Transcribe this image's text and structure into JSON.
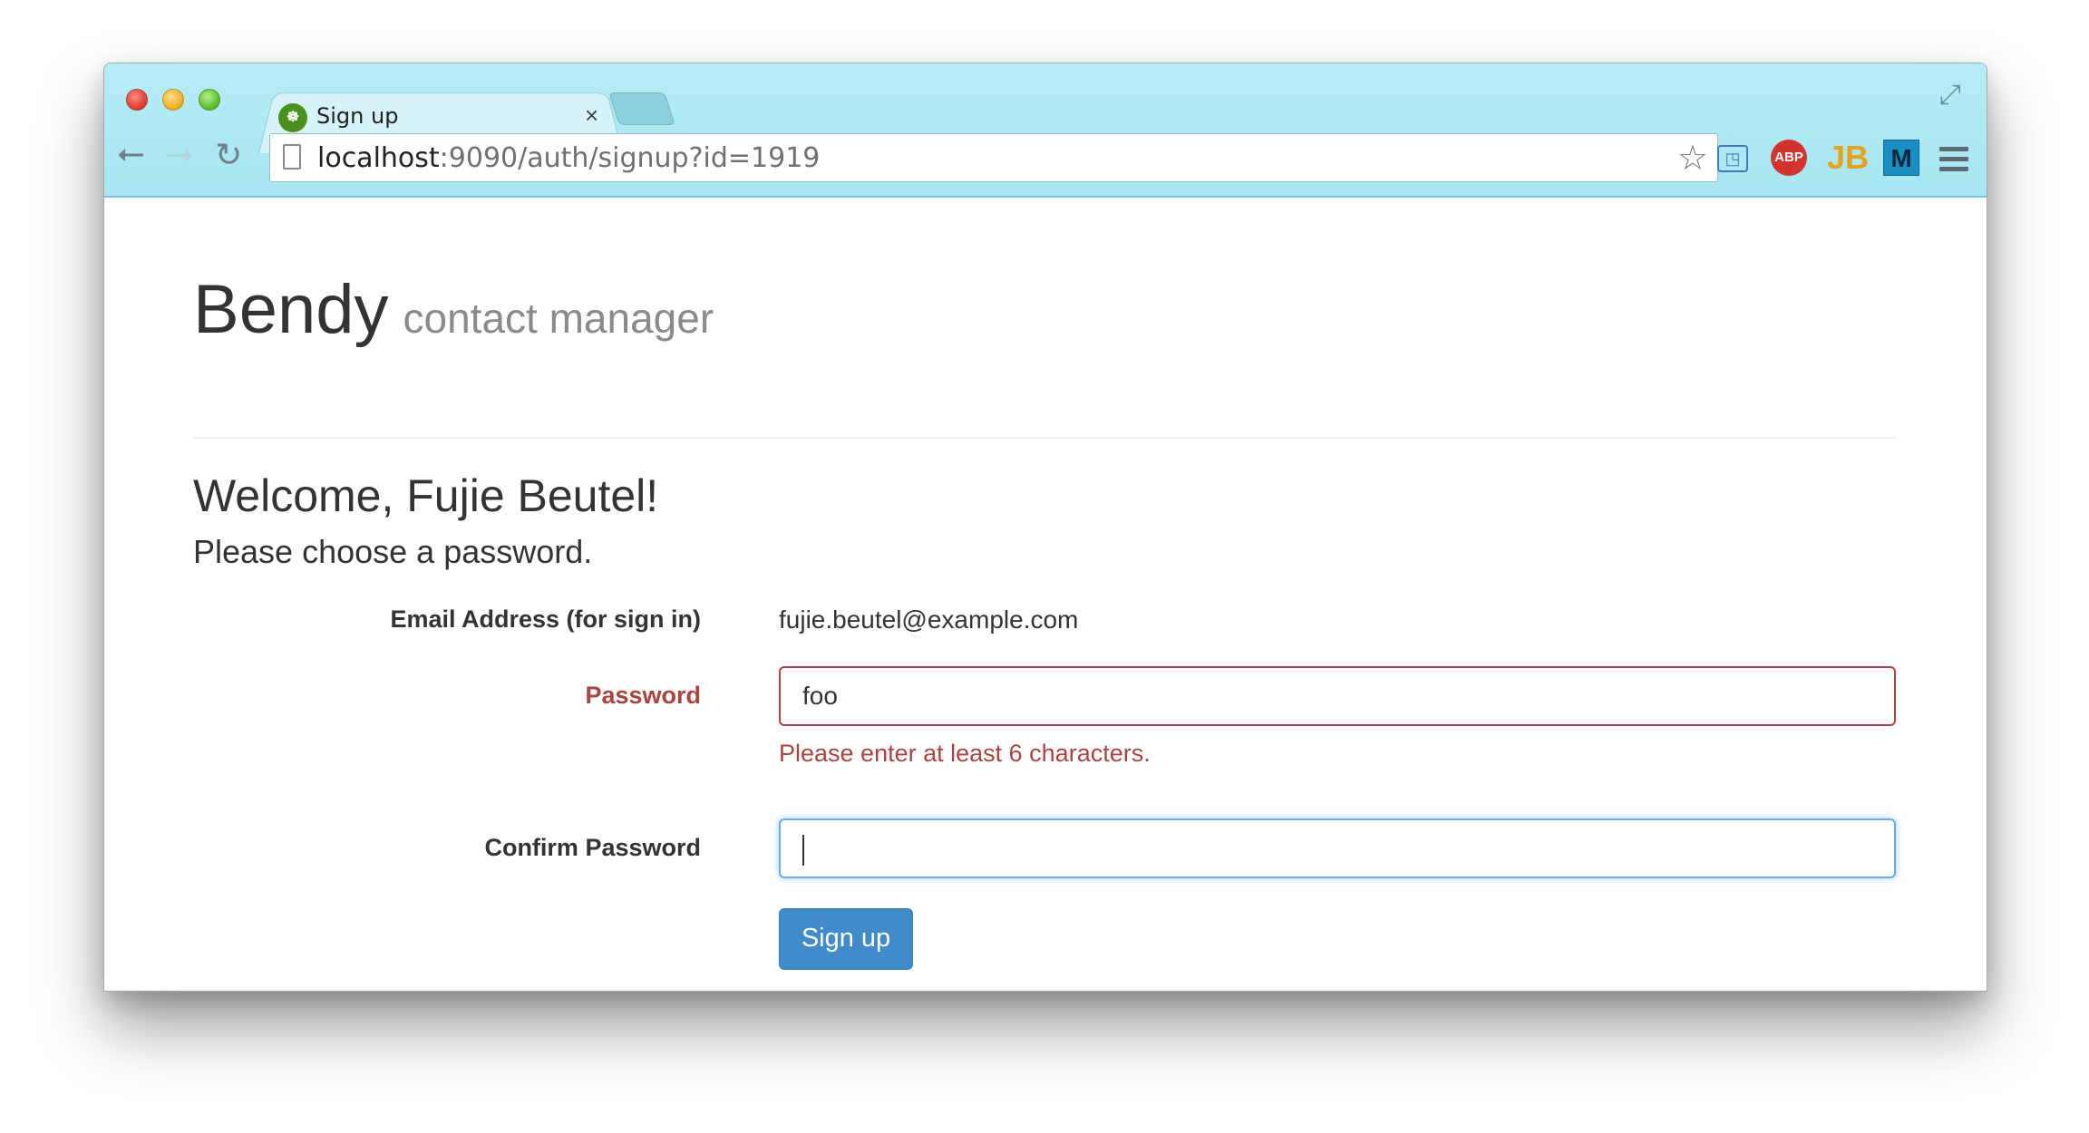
{
  "browser": {
    "tab_title": "Sign up",
    "tab_close": "×",
    "url_host": "localhost",
    "url_rest": ":9090/auth/signup?id=1919",
    "extensions": {
      "abp_label": "ABP",
      "jb_label": "JB",
      "m_label": "M"
    }
  },
  "page": {
    "brand_name": "Bendy",
    "brand_tagline": "contact manager",
    "welcome": "Welcome, Fujie Beutel!",
    "subtitle": "Please choose a password."
  },
  "form": {
    "email_label": "Email Address (for sign in)",
    "email_value": "fujie.beutel@example.com",
    "password_label": "Password",
    "password_value": "foo",
    "password_error": "Please enter at least 6 characters.",
    "confirm_label": "Confirm Password",
    "confirm_value": "",
    "submit_label": "Sign up"
  },
  "colors": {
    "error": "#a94442",
    "focus": "#66afe9",
    "primary": "#428bca",
    "chrome": "#a6e6f2"
  }
}
